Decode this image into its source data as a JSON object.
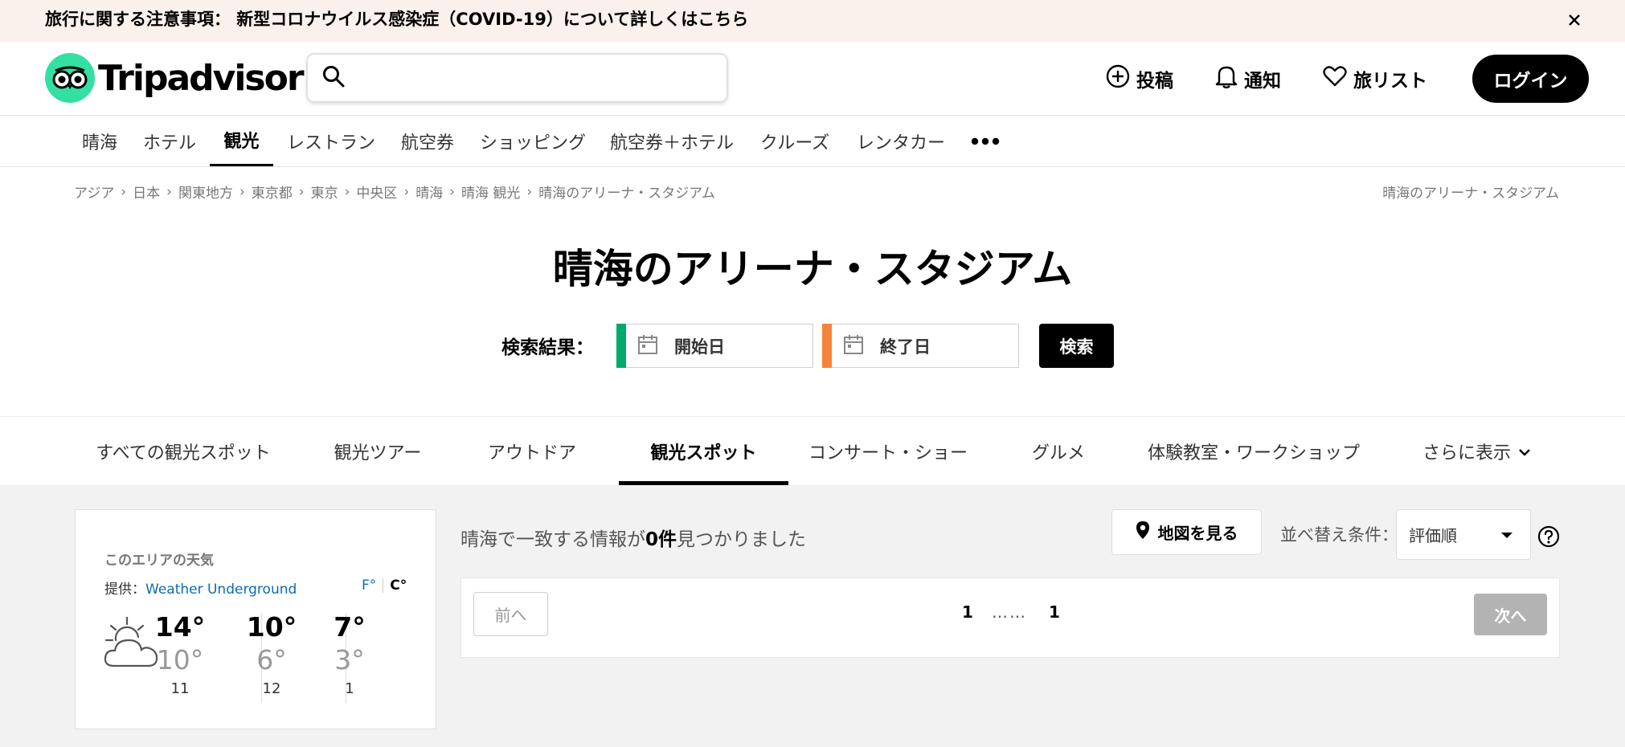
{
  "notice": {
    "text": "旅行に関する注意事項： 新型コロナウイルス感染症（COVID-19）について詳しくはこちら"
  },
  "header": {
    "logo_text": "Tripadvisor",
    "search_placeholder": "",
    "post_label": "投稿",
    "notify_label": "通知",
    "trips_label": "旅リスト",
    "login_label": "ログイン"
  },
  "nav": {
    "items": [
      {
        "label": "晴海"
      },
      {
        "label": "ホテル"
      },
      {
        "label": "観光"
      },
      {
        "label": "レストラン"
      },
      {
        "label": "航空券"
      },
      {
        "label": "ショッピング"
      },
      {
        "label": "航空券＋ホテル"
      },
      {
        "label": "クルーズ"
      },
      {
        "label": "レンタカー"
      }
    ]
  },
  "breadcrumb": {
    "items": [
      "アジア",
      "日本",
      "関東地方",
      "東京都",
      "東京",
      "中央区",
      "晴海",
      "晴海 観光",
      "晴海のアリーナ・スタジアム"
    ],
    "right": "晴海のアリーナ・スタジアム"
  },
  "page_title": "晴海のアリーナ・スタジアム",
  "date_search": {
    "label": "検索結果：",
    "start_label": "開始日",
    "end_label": "終了日",
    "search_label": "検索",
    "start_color": "#00aa6c",
    "end_color": "#f7833a"
  },
  "subnav": {
    "items": [
      {
        "label": "すべての観光スポット"
      },
      {
        "label": "観光ツアー"
      },
      {
        "label": "アウトドア"
      },
      {
        "label": "観光スポット"
      },
      {
        "label": "コンサート・ショー"
      },
      {
        "label": "グルメ"
      },
      {
        "label": "体験教室・ワークショップ"
      }
    ],
    "more_label": "さらに表示"
  },
  "weather": {
    "title": "このエリアの天気",
    "provider_prefix": "提供：",
    "provider_link": "Weather Underground",
    "unit_f": "F°",
    "unit_c": "C°",
    "days": [
      {
        "high": "14°",
        "low": "10°",
        "date": "11"
      },
      {
        "high": "10°",
        "low": "6°",
        "date": "12"
      },
      {
        "high": "7°",
        "low": "3°",
        "date": "1"
      }
    ]
  },
  "results": {
    "prefix": "晴海で一致する情報が",
    "count": "0件",
    "suffix": "見つかりました",
    "map_label": "地図を見る",
    "sort_label": "並べ替え条件：",
    "sort_value": "評価順"
  },
  "pagination": {
    "prev_label": "前へ",
    "next_label": "次へ",
    "first_page": "1",
    "dots": "……",
    "last_page": "1"
  },
  "colors": {
    "brand_green": "#34e0a1",
    "link_blue": "#0b6cb0"
  }
}
